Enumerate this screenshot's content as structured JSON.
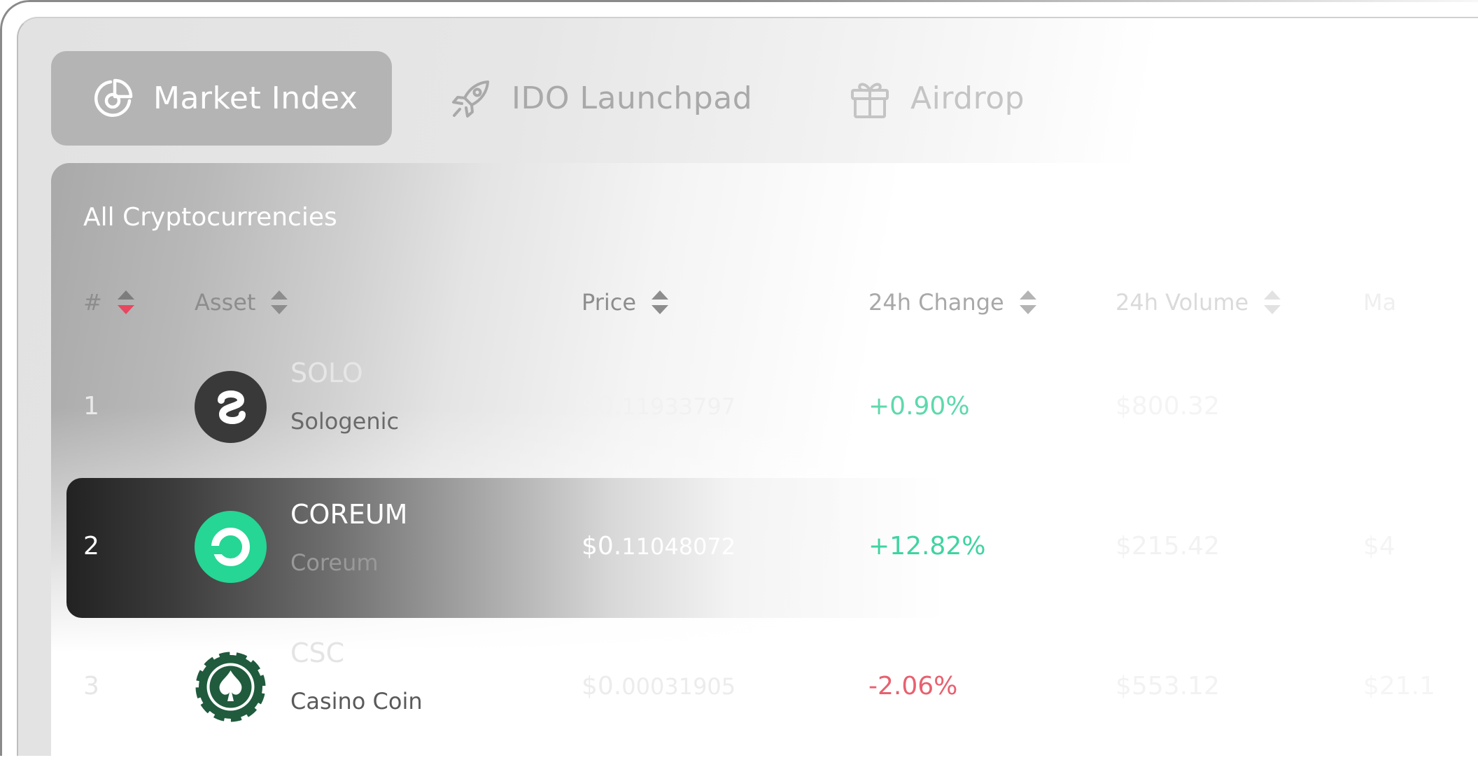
{
  "tabs": [
    {
      "label": "Market Index",
      "icon": "pie-chart-icon",
      "active": true
    },
    {
      "label": "IDO Launchpad",
      "icon": "rocket-icon",
      "active": false
    },
    {
      "label": "Airdrop",
      "icon": "gift-icon",
      "active": false
    }
  ],
  "table": {
    "title": "All Cryptocurrencies",
    "columns": [
      "#",
      "Asset",
      "Price",
      "24h Change",
      "24h Volume",
      "Ma"
    ],
    "rows": [
      {
        "rank": "1",
        "symbol": "SOLO",
        "name": "Sologenic",
        "price_main": "$0.",
        "price_rest": "11933797",
        "change": "+0.90%",
        "volume": "$800.32",
        "extra": ""
      },
      {
        "rank": "2",
        "symbol": "COREUM",
        "name": "Coreum",
        "price_main": "$0.",
        "price_rest": "11048072",
        "change": "+12.82%",
        "volume": "$215.42",
        "extra": "$4"
      },
      {
        "rank": "3",
        "symbol": "CSC",
        "name": "Casino Coin",
        "price_main": "$0.",
        "price_rest": "00031905",
        "change": "-2.06%",
        "volume": "$553.12",
        "extra": "$21.1"
      }
    ]
  },
  "colors": {
    "positive": "#3fd4a0",
    "negative": "#e8606f",
    "sort_active": "#e8475f",
    "highlight_dark": "#222222",
    "coreum_green": "#25d695",
    "csc_green": "#1f5b3c"
  }
}
